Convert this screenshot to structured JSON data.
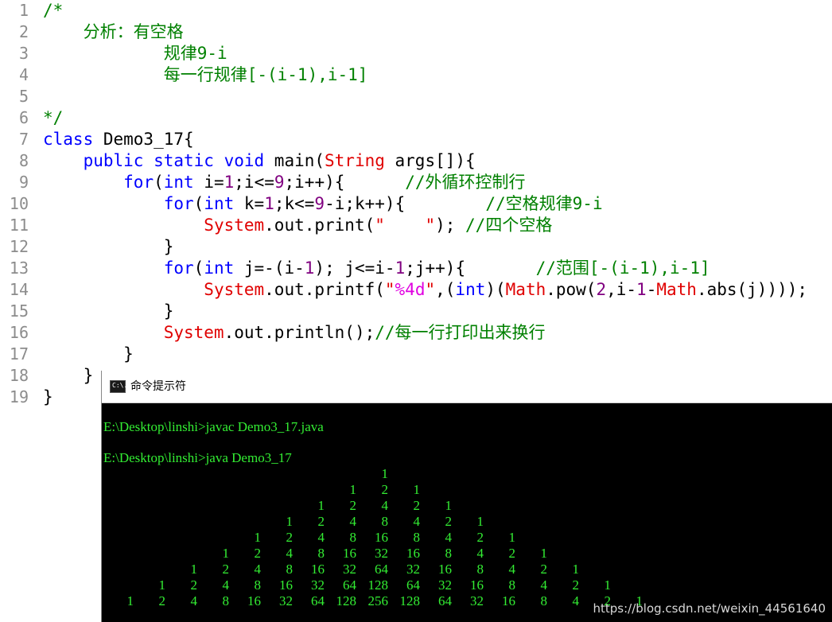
{
  "editor": {
    "lines": [
      {
        "n": "1",
        "code": [
          [
            "cm",
            "/*"
          ]
        ]
      },
      {
        "n": "2",
        "code": [
          [
            "",
            "    "
          ],
          [
            "cm",
            "分析：有空格"
          ]
        ]
      },
      {
        "n": "3",
        "code": [
          [
            "",
            "            "
          ],
          [
            "cm",
            "规律9-i"
          ]
        ]
      },
      {
        "n": "4",
        "code": [
          [
            "",
            "            "
          ],
          [
            "cm",
            "每一行规律[-(i-1),i-1]"
          ]
        ]
      },
      {
        "n": "5",
        "code": []
      },
      {
        "n": "6",
        "code": [
          [
            "cm",
            "*/"
          ]
        ]
      },
      {
        "n": "7",
        "code": [
          [
            "kw",
            "class"
          ],
          [
            "",
            " Demo3_17{"
          ]
        ]
      },
      {
        "n": "8",
        "code": [
          [
            "",
            "    "
          ],
          [
            "kw",
            "public static void"
          ],
          [
            "",
            " main("
          ],
          [
            "cls",
            "String"
          ],
          [
            "",
            " args[]){"
          ]
        ]
      },
      {
        "n": "9",
        "code": [
          [
            "",
            "        "
          ],
          [
            "kw",
            "for"
          ],
          [
            "",
            "("
          ],
          [
            "ty",
            "int"
          ],
          [
            "",
            " i="
          ],
          [
            "num",
            "1"
          ],
          [
            "",
            ";i<="
          ],
          [
            "num",
            "9"
          ],
          [
            "",
            ";i++){      "
          ],
          [
            "cm",
            "//外循环控制行"
          ]
        ]
      },
      {
        "n": "10",
        "code": [
          [
            "",
            "            "
          ],
          [
            "kw",
            "for"
          ],
          [
            "",
            "("
          ],
          [
            "ty",
            "int"
          ],
          [
            "",
            " k="
          ],
          [
            "num",
            "1"
          ],
          [
            "",
            ";k<="
          ],
          [
            "num",
            "9"
          ],
          [
            "",
            "-i;k++){        "
          ],
          [
            "cm",
            "//空格规律9-i"
          ]
        ]
      },
      {
        "n": "11",
        "code": [
          [
            "",
            "                "
          ],
          [
            "cls",
            "System"
          ],
          [
            "",
            ".out.print("
          ],
          [
            "str",
            "\"    \""
          ],
          [
            "",
            "); "
          ],
          [
            "cm",
            "//四个空格"
          ]
        ]
      },
      {
        "n": "12",
        "code": [
          [
            "",
            "            }"
          ]
        ]
      },
      {
        "n": "13",
        "code": [
          [
            "",
            "            "
          ],
          [
            "kw",
            "for"
          ],
          [
            "",
            "("
          ],
          [
            "ty",
            "int"
          ],
          [
            "",
            " j=-(i-"
          ],
          [
            "num",
            "1"
          ],
          [
            "",
            "); j<=i-"
          ],
          [
            "num",
            "1"
          ],
          [
            "",
            ";j++){       "
          ],
          [
            "cm",
            "//范围[-(i-1),i-1]"
          ]
        ]
      },
      {
        "n": "14",
        "code": [
          [
            "",
            "                "
          ],
          [
            "cls",
            "System"
          ],
          [
            "",
            ".out.printf("
          ],
          [
            "str",
            "\""
          ],
          [
            "fmt",
            "%4d"
          ],
          [
            "str",
            "\""
          ],
          [
            "",
            ",("
          ],
          [
            "ty",
            "int"
          ],
          [
            "",
            ")("
          ],
          [
            "cls",
            "Math"
          ],
          [
            "",
            ".pow("
          ],
          [
            "num",
            "2"
          ],
          [
            "",
            ",i-"
          ],
          [
            "num",
            "1"
          ],
          [
            "",
            "-"
          ],
          [
            "cls",
            "Math"
          ],
          [
            "",
            ".abs(j))));"
          ]
        ]
      },
      {
        "n": "15",
        "code": [
          [
            "",
            "            }"
          ]
        ]
      },
      {
        "n": "16",
        "code": [
          [
            "",
            "            "
          ],
          [
            "cls",
            "System"
          ],
          [
            "",
            ".out.println();"
          ],
          [
            "cm",
            "//每一行打印出来换行"
          ]
        ]
      },
      {
        "n": "17",
        "code": [
          [
            "",
            "        }"
          ]
        ]
      },
      {
        "n": "18",
        "code": [
          [
            "",
            "    }"
          ]
        ]
      },
      {
        "n": "19",
        "code": [
          [
            "",
            "}"
          ]
        ]
      }
    ]
  },
  "cmd": {
    "title": "命令提示符",
    "icon_text": "C:\\.",
    "lines": [
      "E:\\Desktop\\linshi>javac Demo3_17.java",
      "E:\\Desktop\\linshi>java Demo3_17"
    ],
    "triangle": [
      [
        "1"
      ],
      [
        "1",
        "2",
        "1"
      ],
      [
        "1",
        "2",
        "4",
        "2",
        "1"
      ],
      [
        "1",
        "2",
        "4",
        "8",
        "4",
        "2",
        "1"
      ],
      [
        "1",
        "2",
        "4",
        "8",
        "16",
        "8",
        "4",
        "2",
        "1"
      ],
      [
        "1",
        "2",
        "4",
        "8",
        "16",
        "32",
        "16",
        "8",
        "4",
        "2",
        "1"
      ],
      [
        "1",
        "2",
        "4",
        "8",
        "16",
        "32",
        "64",
        "32",
        "16",
        "8",
        "4",
        "2",
        "1"
      ],
      [
        "1",
        "2",
        "4",
        "8",
        "16",
        "32",
        "64",
        "128",
        "64",
        "32",
        "16",
        "8",
        "4",
        "2",
        "1"
      ],
      [
        "1",
        "2",
        "4",
        "8",
        "16",
        "32",
        "64",
        "128",
        "256",
        "128",
        "64",
        "32",
        "16",
        "8",
        "4",
        "2",
        "1"
      ]
    ]
  },
  "watermark": "https://blog.csdn.net/weixin_44561640"
}
